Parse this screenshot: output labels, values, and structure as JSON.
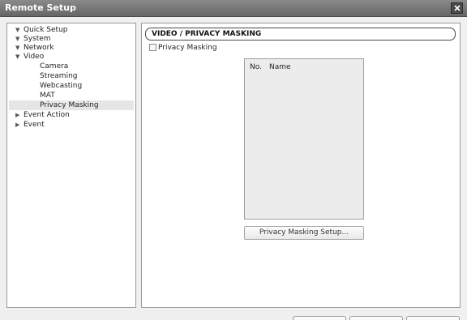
{
  "window": {
    "title": "Remote Setup"
  },
  "tree": {
    "items": [
      {
        "label": "Quick Setup",
        "expanded": true,
        "level": 0,
        "selected": false
      },
      {
        "label": "System",
        "expanded": true,
        "level": 0,
        "selected": false
      },
      {
        "label": "Network",
        "expanded": true,
        "level": 0,
        "selected": false
      },
      {
        "label": "Video",
        "expanded": true,
        "level": 0,
        "selected": false
      },
      {
        "label": "Camera",
        "level": 1,
        "selected": false
      },
      {
        "label": "Streaming",
        "level": 1,
        "selected": false
      },
      {
        "label": "Webcasting",
        "level": 1,
        "selected": false
      },
      {
        "label": "MAT",
        "level": 1,
        "selected": false
      },
      {
        "label": "Privacy Masking",
        "level": 1,
        "selected": true
      },
      {
        "label": "Event Action",
        "expanded": false,
        "level": 0,
        "selected": false
      },
      {
        "label": "Event",
        "expanded": false,
        "level": 0,
        "selected": false
      }
    ]
  },
  "content": {
    "section_title": "VIDEO / PRIVACY MASKING",
    "checkbox_label": "Privacy Masking",
    "checkbox_checked": false,
    "list": {
      "col_no": "No.",
      "col_name": "Name",
      "rows": []
    },
    "setup_button": "Privacy Masking Setup..."
  },
  "icons": {
    "close": "close-icon",
    "expanded_arrow": "triangle-down-icon",
    "collapsed_arrow": "triangle-right-icon"
  },
  "colors": {
    "titlebar": "#777777",
    "selection": "#e6e6e6"
  }
}
